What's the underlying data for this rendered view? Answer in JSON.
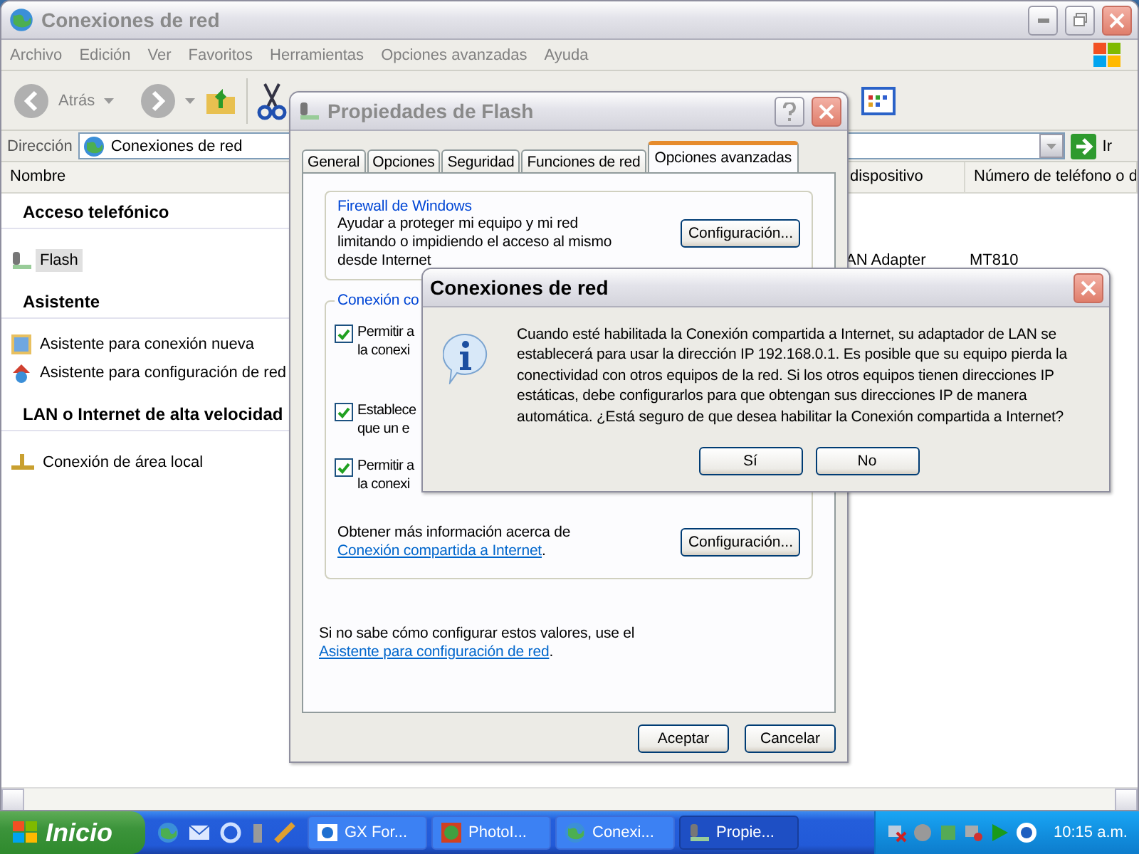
{
  "explorer": {
    "title": "Conexiones de red",
    "active": false,
    "menu": [
      "Archivo",
      "Edición",
      "Ver",
      "Favoritos",
      "Herramientas",
      "Opciones avanzadas",
      "Ayuda"
    ],
    "back_label": "Atrás",
    "address": {
      "label": "Dirección",
      "value": "Conexiones de red",
      "go": "Ir"
    },
    "columns": [
      "Nombre",
      "dispositivo",
      "Número de teléfono o d"
    ],
    "groups": [
      {
        "title": "Acceso telefónico",
        "items": [
          {
            "name": "Flash",
            "kind": "dialup",
            "selected": true,
            "cells": [
              "AN Adapter",
              "MT810"
            ]
          }
        ]
      },
      {
        "title": "Asistente",
        "items": [
          {
            "name": "Asistente para conexión nueva",
            "kind": "wizard",
            "selected": false
          },
          {
            "name": "Asistente para configuración de red",
            "kind": "network-wizard",
            "selected": false
          }
        ]
      },
      {
        "title": "LAN o Internet de alta velocidad",
        "items": [
          {
            "name": "Conexión de área local",
            "kind": "lan",
            "selected": false
          }
        ]
      }
    ]
  },
  "properties": {
    "title": "Propiedades de Flash",
    "active": false,
    "tabs": [
      {
        "label": "General",
        "selected": false
      },
      {
        "label": "Opciones",
        "selected": false
      },
      {
        "label": "Seguridad",
        "selected": false
      },
      {
        "label": "Funciones de red",
        "selected": false
      },
      {
        "label": "Opciones avanzadas",
        "selected": true
      }
    ],
    "firewall": {
      "title": "Firewall de Windows",
      "text": "Ayudar a proteger mi equipo y mi red limitando o impidiendo el acceso al mismo desde Internet",
      "button": "Configuración..."
    },
    "sharing": {
      "title": "Conexión co",
      "checkboxes": [
        {
          "lines": [
            "Permitir a",
            "la conexi"
          ],
          "checked": true
        },
        {
          "lines": [
            "Establece",
            "que un e"
          ],
          "checked": true
        },
        {
          "lines": [
            "Permitir a",
            "la conexi"
          ],
          "checked": true
        }
      ],
      "info": {
        "text": "Obtener más información acerca de",
        "link": "Conexión compartida a Internet",
        "after": "."
      },
      "button": "Configuración..."
    },
    "footer": {
      "text": "Si no sabe cómo configurar estos valores, use el",
      "link": "Asistente para configuración de red",
      "after": "."
    },
    "buttons": [
      "Aceptar",
      "Cancelar"
    ]
  },
  "message": {
    "title": "Conexiones de red",
    "active": true,
    "text": "Cuando esté habilitada la Conexión compartida a Internet, su adaptador de LAN se establecerá para usar la dirección IP 192.168.0.1. Es posible que su equipo pierda la conectividad con otros equipos de la red. Si los otros equipos tienen direcciones IP estáticas, debe configurarlos para que obtengan sus direcciones IP de manera automática. ¿Está seguro de que desea habilitar la Conexión compartida a Internet?",
    "buttons": [
      "Sí",
      "No"
    ]
  },
  "taskbar": {
    "start": "Inicio",
    "tasks": [
      {
        "label": "GX For...",
        "kind": "browser",
        "selected": false
      },
      {
        "label": "PhotoI...",
        "kind": "photo",
        "selected": false
      },
      {
        "label": "Conexi...",
        "kind": "network",
        "selected": false
      },
      {
        "label": "Propie...",
        "kind": "dialup",
        "selected": true
      }
    ],
    "clock": "10:15 a.m."
  }
}
